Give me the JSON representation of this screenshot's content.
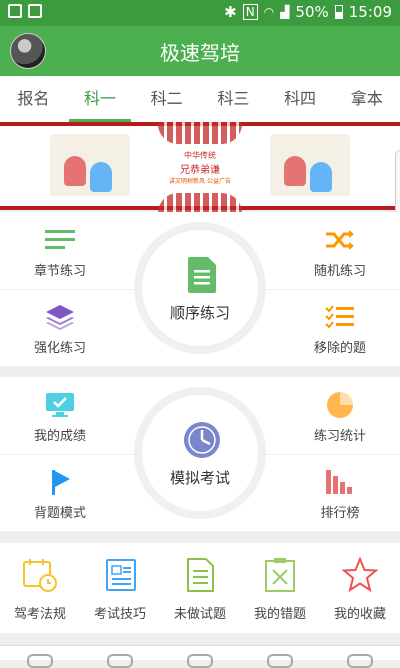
{
  "statusbar": {
    "battery": "50%",
    "time": "15:09"
  },
  "appbar": {
    "title": "极速驾培"
  },
  "tabs": [
    "报名",
    "科一",
    "科二",
    "科三",
    "科四",
    "拿本"
  ],
  "banner": {
    "line1": "中华传统",
    "line2": "兄恭弟谦",
    "line3": "讲文明树新风 公益广告"
  },
  "panel1": {
    "tl": "章节练习",
    "tr": "随机练习",
    "bl": "强化练习",
    "br": "移除的题",
    "hub": "顺序练习"
  },
  "panel2": {
    "tl": "我的成绩",
    "tr": "练习统计",
    "bl": "背题模式",
    "br": "排行榜",
    "hub": "模拟考试"
  },
  "grid": [
    "驾考法规",
    "考试技巧",
    "未做试题",
    "我的错题",
    "我的收藏"
  ],
  "colors": {
    "accent": "#4caf50",
    "statusbar": "#3c9a3f"
  }
}
